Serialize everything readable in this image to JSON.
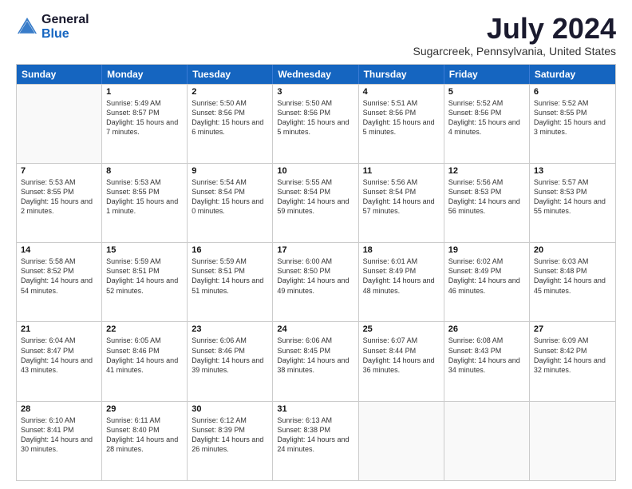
{
  "logo": {
    "general": "General",
    "blue": "Blue"
  },
  "title": "July 2024",
  "subtitle": "Sugarcreek, Pennsylvania, United States",
  "days": [
    "Sunday",
    "Monday",
    "Tuesday",
    "Wednesday",
    "Thursday",
    "Friday",
    "Saturday"
  ],
  "weeks": [
    [
      {
        "date": "",
        "sunrise": "",
        "sunset": "",
        "daylight": ""
      },
      {
        "date": "1",
        "sunrise": "Sunrise: 5:49 AM",
        "sunset": "Sunset: 8:57 PM",
        "daylight": "Daylight: 15 hours and 7 minutes."
      },
      {
        "date": "2",
        "sunrise": "Sunrise: 5:50 AM",
        "sunset": "Sunset: 8:56 PM",
        "daylight": "Daylight: 15 hours and 6 minutes."
      },
      {
        "date": "3",
        "sunrise": "Sunrise: 5:50 AM",
        "sunset": "Sunset: 8:56 PM",
        "daylight": "Daylight: 15 hours and 5 minutes."
      },
      {
        "date": "4",
        "sunrise": "Sunrise: 5:51 AM",
        "sunset": "Sunset: 8:56 PM",
        "daylight": "Daylight: 15 hours and 5 minutes."
      },
      {
        "date": "5",
        "sunrise": "Sunrise: 5:52 AM",
        "sunset": "Sunset: 8:56 PM",
        "daylight": "Daylight: 15 hours and 4 minutes."
      },
      {
        "date": "6",
        "sunrise": "Sunrise: 5:52 AM",
        "sunset": "Sunset: 8:55 PM",
        "daylight": "Daylight: 15 hours and 3 minutes."
      }
    ],
    [
      {
        "date": "7",
        "sunrise": "Sunrise: 5:53 AM",
        "sunset": "Sunset: 8:55 PM",
        "daylight": "Daylight: 15 hours and 2 minutes."
      },
      {
        "date": "8",
        "sunrise": "Sunrise: 5:53 AM",
        "sunset": "Sunset: 8:55 PM",
        "daylight": "Daylight: 15 hours and 1 minute."
      },
      {
        "date": "9",
        "sunrise": "Sunrise: 5:54 AM",
        "sunset": "Sunset: 8:54 PM",
        "daylight": "Daylight: 15 hours and 0 minutes."
      },
      {
        "date": "10",
        "sunrise": "Sunrise: 5:55 AM",
        "sunset": "Sunset: 8:54 PM",
        "daylight": "Daylight: 14 hours and 59 minutes."
      },
      {
        "date": "11",
        "sunrise": "Sunrise: 5:56 AM",
        "sunset": "Sunset: 8:54 PM",
        "daylight": "Daylight: 14 hours and 57 minutes."
      },
      {
        "date": "12",
        "sunrise": "Sunrise: 5:56 AM",
        "sunset": "Sunset: 8:53 PM",
        "daylight": "Daylight: 14 hours and 56 minutes."
      },
      {
        "date": "13",
        "sunrise": "Sunrise: 5:57 AM",
        "sunset": "Sunset: 8:53 PM",
        "daylight": "Daylight: 14 hours and 55 minutes."
      }
    ],
    [
      {
        "date": "14",
        "sunrise": "Sunrise: 5:58 AM",
        "sunset": "Sunset: 8:52 PM",
        "daylight": "Daylight: 14 hours and 54 minutes."
      },
      {
        "date": "15",
        "sunrise": "Sunrise: 5:59 AM",
        "sunset": "Sunset: 8:51 PM",
        "daylight": "Daylight: 14 hours and 52 minutes."
      },
      {
        "date": "16",
        "sunrise": "Sunrise: 5:59 AM",
        "sunset": "Sunset: 8:51 PM",
        "daylight": "Daylight: 14 hours and 51 minutes."
      },
      {
        "date": "17",
        "sunrise": "Sunrise: 6:00 AM",
        "sunset": "Sunset: 8:50 PM",
        "daylight": "Daylight: 14 hours and 49 minutes."
      },
      {
        "date": "18",
        "sunrise": "Sunrise: 6:01 AM",
        "sunset": "Sunset: 8:49 PM",
        "daylight": "Daylight: 14 hours and 48 minutes."
      },
      {
        "date": "19",
        "sunrise": "Sunrise: 6:02 AM",
        "sunset": "Sunset: 8:49 PM",
        "daylight": "Daylight: 14 hours and 46 minutes."
      },
      {
        "date": "20",
        "sunrise": "Sunrise: 6:03 AM",
        "sunset": "Sunset: 8:48 PM",
        "daylight": "Daylight: 14 hours and 45 minutes."
      }
    ],
    [
      {
        "date": "21",
        "sunrise": "Sunrise: 6:04 AM",
        "sunset": "Sunset: 8:47 PM",
        "daylight": "Daylight: 14 hours and 43 minutes."
      },
      {
        "date": "22",
        "sunrise": "Sunrise: 6:05 AM",
        "sunset": "Sunset: 8:46 PM",
        "daylight": "Daylight: 14 hours and 41 minutes."
      },
      {
        "date": "23",
        "sunrise": "Sunrise: 6:06 AM",
        "sunset": "Sunset: 8:46 PM",
        "daylight": "Daylight: 14 hours and 39 minutes."
      },
      {
        "date": "24",
        "sunrise": "Sunrise: 6:06 AM",
        "sunset": "Sunset: 8:45 PM",
        "daylight": "Daylight: 14 hours and 38 minutes."
      },
      {
        "date": "25",
        "sunrise": "Sunrise: 6:07 AM",
        "sunset": "Sunset: 8:44 PM",
        "daylight": "Daylight: 14 hours and 36 minutes."
      },
      {
        "date": "26",
        "sunrise": "Sunrise: 6:08 AM",
        "sunset": "Sunset: 8:43 PM",
        "daylight": "Daylight: 14 hours and 34 minutes."
      },
      {
        "date": "27",
        "sunrise": "Sunrise: 6:09 AM",
        "sunset": "Sunset: 8:42 PM",
        "daylight": "Daylight: 14 hours and 32 minutes."
      }
    ],
    [
      {
        "date": "28",
        "sunrise": "Sunrise: 6:10 AM",
        "sunset": "Sunset: 8:41 PM",
        "daylight": "Daylight: 14 hours and 30 minutes."
      },
      {
        "date": "29",
        "sunrise": "Sunrise: 6:11 AM",
        "sunset": "Sunset: 8:40 PM",
        "daylight": "Daylight: 14 hours and 28 minutes."
      },
      {
        "date": "30",
        "sunrise": "Sunrise: 6:12 AM",
        "sunset": "Sunset: 8:39 PM",
        "daylight": "Daylight: 14 hours and 26 minutes."
      },
      {
        "date": "31",
        "sunrise": "Sunrise: 6:13 AM",
        "sunset": "Sunset: 8:38 PM",
        "daylight": "Daylight: 14 hours and 24 minutes."
      },
      {
        "date": "",
        "sunrise": "",
        "sunset": "",
        "daylight": ""
      },
      {
        "date": "",
        "sunrise": "",
        "sunset": "",
        "daylight": ""
      },
      {
        "date": "",
        "sunrise": "",
        "sunset": "",
        "daylight": ""
      }
    ]
  ]
}
